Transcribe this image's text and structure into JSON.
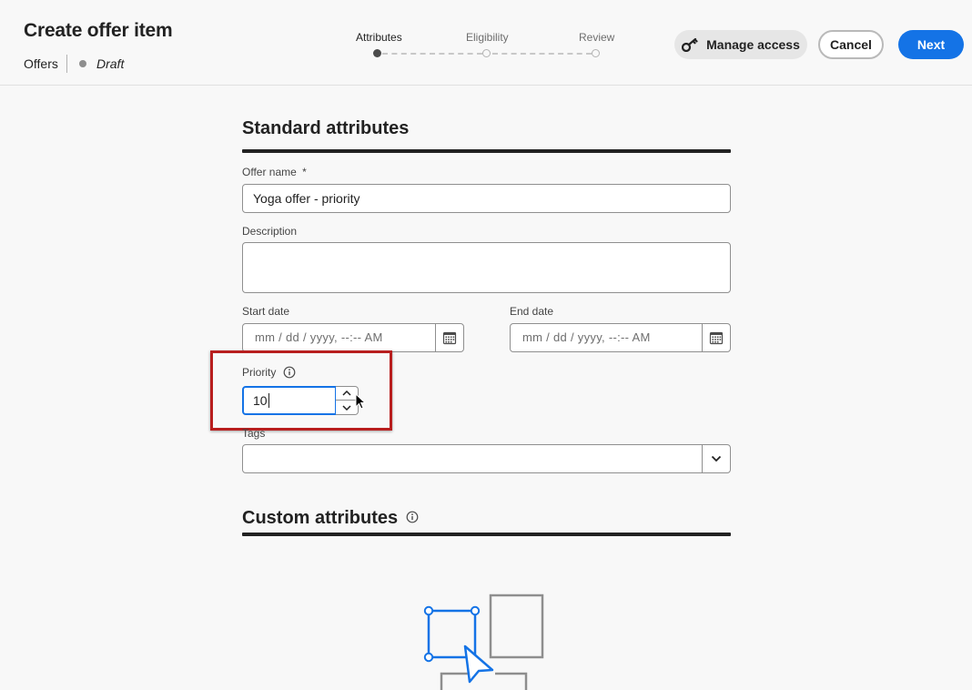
{
  "header": {
    "title": "Create offer item",
    "breadcrumb": "Offers",
    "status": "Draft"
  },
  "stepper": {
    "steps": [
      {
        "label": "Attributes",
        "state": "current"
      },
      {
        "label": "Eligibility",
        "state": "upcoming"
      },
      {
        "label": "Review",
        "state": "upcoming"
      }
    ]
  },
  "actions": {
    "manage_access": "Manage access",
    "cancel": "Cancel",
    "next": "Next"
  },
  "standard_attributes": {
    "title": "Standard attributes",
    "offer_name": {
      "label": "Offer name",
      "required_mark": "*",
      "value": "Yoga offer - priority"
    },
    "description": {
      "label": "Description",
      "value": ""
    },
    "start_date": {
      "label": "Start date",
      "placeholder": "mm / dd / yyyy, --:-- AM"
    },
    "end_date": {
      "label": "End date",
      "placeholder": "mm / dd / yyyy, --:-- AM"
    },
    "priority": {
      "label": "Priority",
      "value": "10"
    },
    "tags": {
      "label": "Tags",
      "value": ""
    }
  },
  "custom_attributes": {
    "title": "Custom attributes"
  },
  "colors": {
    "accent": "#1473e6",
    "highlight": "#b81e1e",
    "text": "#222222"
  },
  "icons": [
    "key-icon",
    "calendar-icon",
    "info-icon",
    "chevron-up-icon",
    "chevron-down-icon",
    "mouse-cursor-icon",
    "empty-state-illustration"
  ]
}
